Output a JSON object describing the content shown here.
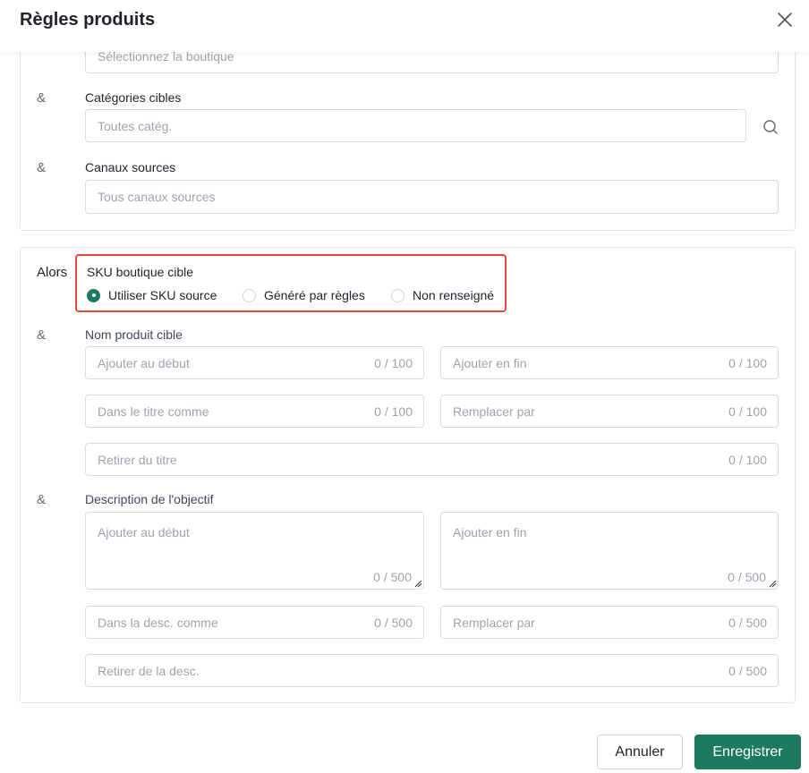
{
  "dialog": {
    "title": "Règles produits"
  },
  "conditions": {
    "boutique_placeholder": "Sélectionnez la boutique",
    "amp": "&",
    "categories_label": "Catégories cibles",
    "categories_placeholder": "Toutes catég.",
    "canaux_label": "Canaux sources",
    "canaux_placeholder": "Tous canaux sources"
  },
  "actions": {
    "alors": "Alors",
    "sku_label": "SKU boutique cible",
    "sku_options": [
      {
        "label": "Utiliser SKU source",
        "selected": true
      },
      {
        "label": "Généré par règles",
        "selected": false
      },
      {
        "label": "Non renseigné",
        "selected": false
      }
    ],
    "nom_label": "Nom produit cible",
    "nom_fields": {
      "ajouter_debut": {
        "placeholder": "Ajouter au début",
        "count": "0 / 100"
      },
      "ajouter_fin": {
        "placeholder": "Ajouter en fin",
        "count": "0 / 100"
      },
      "titre_comme": {
        "placeholder": "Dans le titre comme",
        "count": "0 / 100"
      },
      "remplacer": {
        "placeholder": "Remplacer par",
        "count": "0 / 100"
      },
      "retirer": {
        "placeholder": "Retirer du titre",
        "count": "0 / 100"
      }
    },
    "desc_label": "Description de l'objectif",
    "desc_fields": {
      "ajouter_debut": {
        "placeholder": "Ajouter au début",
        "count": "0 / 500"
      },
      "ajouter_fin": {
        "placeholder": "Ajouter en fin",
        "count": "0 / 500"
      },
      "desc_comme": {
        "placeholder": "Dans la desc. comme",
        "count": "0 / 500"
      },
      "remplacer": {
        "placeholder": "Remplacer par",
        "count": "0 / 500"
      },
      "retirer": {
        "placeholder": "Retirer de la desc.",
        "count": "0 / 500"
      }
    }
  },
  "footer": {
    "cancel": "Annuler",
    "save": "Enregistrer"
  },
  "colors": {
    "primary": "#1d7a5f",
    "highlight": "#e5483f",
    "placeholder": "#9ea3ab"
  },
  "icons": {
    "close": "close-icon",
    "search": "search-icon",
    "resize": "resize-handle-icon"
  }
}
